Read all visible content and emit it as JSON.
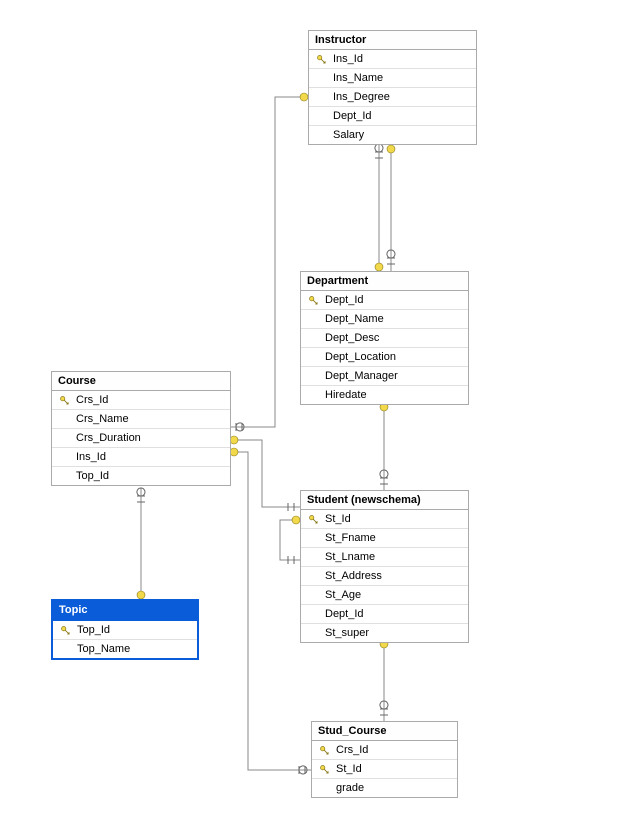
{
  "tables": {
    "instructor": {
      "title": "Instructor",
      "columns": [
        {
          "name": "Ins_Id",
          "pk": true
        },
        {
          "name": "Ins_Name",
          "pk": false
        },
        {
          "name": "Ins_Degree",
          "pk": false
        },
        {
          "name": "Dept_Id",
          "pk": false
        },
        {
          "name": "Salary",
          "pk": false
        }
      ]
    },
    "department": {
      "title": "Department",
      "columns": [
        {
          "name": "Dept_Id",
          "pk": true
        },
        {
          "name": "Dept_Name",
          "pk": false
        },
        {
          "name": "Dept_Desc",
          "pk": false
        },
        {
          "name": "Dept_Location",
          "pk": false
        },
        {
          "name": "Dept_Manager",
          "pk": false
        },
        {
          "name": "Hiredate",
          "pk": false
        }
      ]
    },
    "course": {
      "title": "Course",
      "columns": [
        {
          "name": "Crs_Id",
          "pk": true
        },
        {
          "name": "Crs_Name",
          "pk": false
        },
        {
          "name": "Crs_Duration",
          "pk": false
        },
        {
          "name": "Ins_Id",
          "pk": false
        },
        {
          "name": "Top_Id",
          "pk": false
        }
      ]
    },
    "student": {
      "title": "Student (newschema)",
      "columns": [
        {
          "name": "St_Id",
          "pk": true
        },
        {
          "name": "St_Fname",
          "pk": false
        },
        {
          "name": "St_Lname",
          "pk": false
        },
        {
          "name": "St_Address",
          "pk": false
        },
        {
          "name": "St_Age",
          "pk": false
        },
        {
          "name": "Dept_Id",
          "pk": false
        },
        {
          "name": "St_super",
          "pk": false
        }
      ]
    },
    "topic": {
      "title": "Topic",
      "columns": [
        {
          "name": "Top_Id",
          "pk": true
        },
        {
          "name": "Top_Name",
          "pk": false
        }
      ]
    },
    "stud_course": {
      "title": "Stud_Course",
      "columns": [
        {
          "name": "Crs_Id",
          "pk": true
        },
        {
          "name": "St_Id",
          "pk": true
        },
        {
          "name": "grade",
          "pk": false
        }
      ]
    }
  },
  "relationships": [
    {
      "from": "Instructor.Dept_Id",
      "to": "Department.Dept_Id"
    },
    {
      "from": "Department.Dept_Manager",
      "to": "Instructor.Ins_Id"
    },
    {
      "from": "Course.Ins_Id",
      "to": "Instructor.Ins_Id"
    },
    {
      "from": "Course.Top_Id",
      "to": "Topic.Top_Id"
    },
    {
      "from": "Student.Dept_Id",
      "to": "Department.Dept_Id"
    },
    {
      "from": "Student.St_super",
      "to": "Student.St_Id"
    },
    {
      "from": "Stud_Course.Crs_Id",
      "to": "Course.Crs_Id"
    },
    {
      "from": "Stud_Course.St_Id",
      "to": "Student.St_Id"
    }
  ],
  "selected_table": "topic"
}
